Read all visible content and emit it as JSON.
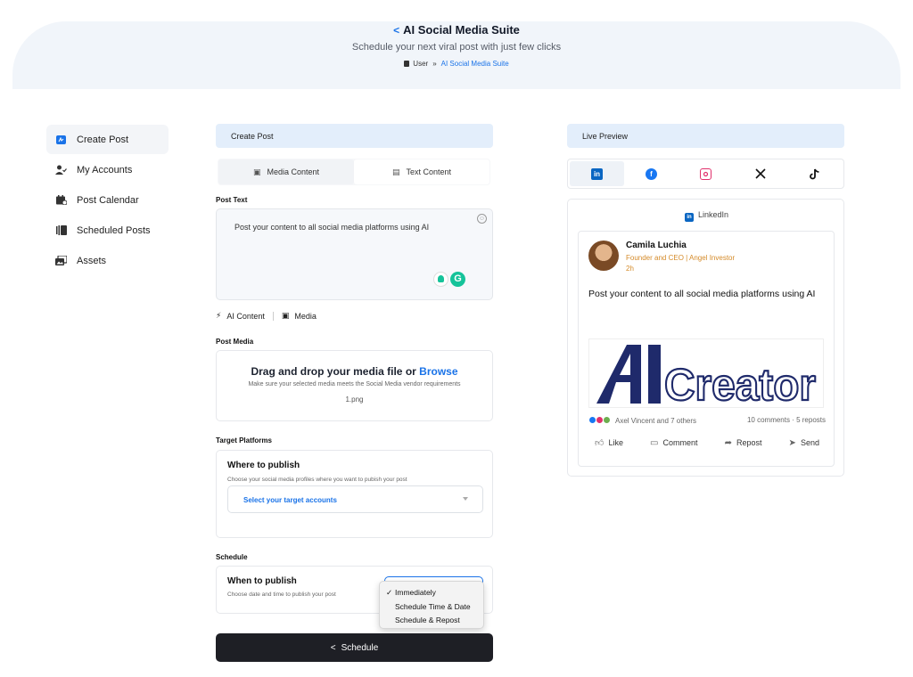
{
  "header": {
    "title": "AI Social Media Suite",
    "subtitle": "Schedule your next viral post with just few clicks",
    "breadcrumb": {
      "home": "User",
      "separator": "»",
      "current": "AI Social Media Suite"
    }
  },
  "sidebar": {
    "items": [
      {
        "label": "Create Post",
        "icon": "compose-icon",
        "active": true
      },
      {
        "label": "My Accounts",
        "icon": "user-check-icon",
        "active": false
      },
      {
        "label": "Post Calendar",
        "icon": "calendar-icon",
        "active": false
      },
      {
        "label": "Scheduled Posts",
        "icon": "list-icon",
        "active": false
      },
      {
        "label": "Assets",
        "icon": "images-icon",
        "active": false
      }
    ]
  },
  "create": {
    "panel_title": "Create Post",
    "tabs": {
      "media": "Media Content",
      "text": "Text Content"
    },
    "post_text_label": "Post Text",
    "post_text_value": "Post your content to all social media platforms using AI",
    "tools": {
      "ai": "AI Content",
      "media": "Media"
    },
    "post_media_label": "Post Media",
    "drop": {
      "heading": "Drag and drop your media file or",
      "browse": "Browse",
      "note": "Make sure your selected media meets the Social Media vendor requirements",
      "file": "1.png"
    },
    "target_label": "Target Platforms",
    "where": {
      "title": "Where to publish",
      "subtitle": "Choose your social media profiles where you want to pubish your post",
      "placeholder": "Select your target accounts"
    },
    "schedule_label": "Schedule",
    "when": {
      "title": "When to publish",
      "subtitle": "Choose date and time to publish your post",
      "options": [
        "Immediately",
        "Schedule Time & Date",
        "Schedule & Repost"
      ],
      "selected": "Immediately",
      "check": "✓"
    },
    "submit": "Schedule"
  },
  "preview": {
    "panel_title": "Live Preview",
    "platforms": [
      "linkedin-icon",
      "facebook-icon",
      "instagram-icon",
      "x-icon",
      "tiktok-icon"
    ],
    "network": "LinkedIn",
    "author": {
      "name": "Camila Luchia",
      "title": "Founder and CEO | Angel Investor",
      "time": "2h"
    },
    "text": "Post your content to all social media platforms using AI",
    "image_text": {
      "a": "AI",
      "b": "Creator"
    },
    "stats": {
      "reactions": "Axel Vincent and 7 others",
      "counts": "10 comments · 5 reposts"
    },
    "actions": [
      "Like",
      "Comment",
      "Repost",
      "Send"
    ]
  },
  "colors": {
    "accent": "#1a73e8",
    "linkedin": "#0a66c2",
    "facebook": "#1877f2",
    "instagram": "#e1306c",
    "dark": "#1e1f25"
  }
}
